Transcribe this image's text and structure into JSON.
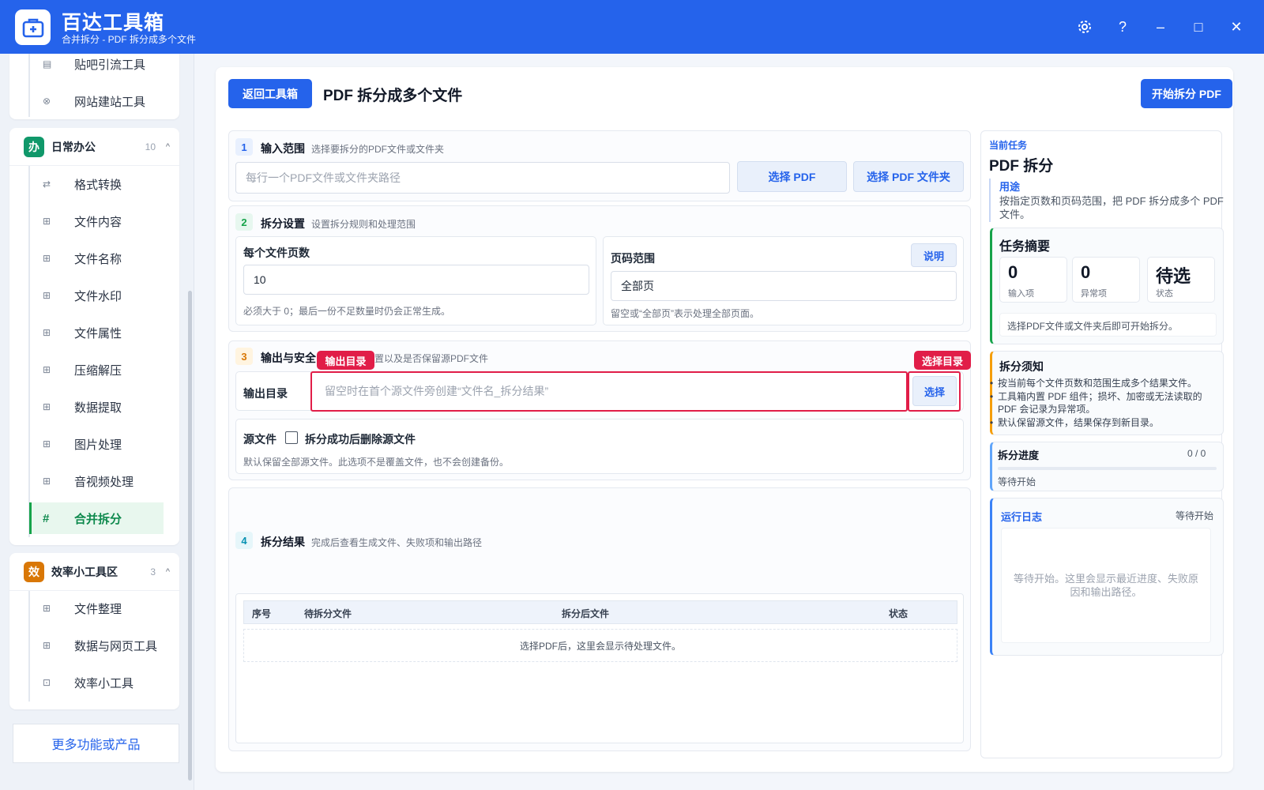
{
  "app": {
    "title": "百达工具箱",
    "subtitle": "合并拆分 - PDF 拆分成多个文件",
    "icons": [
      "settings-icon",
      "help-icon",
      "minimize-icon",
      "maximize-icon",
      "close-icon"
    ],
    "help_glyph": "?",
    "minimize_glyph": "–",
    "maximize_glyph": "□",
    "close_glyph": "✕"
  },
  "sidebar": {
    "top_items": [
      {
        "label": "贴吧引流工具",
        "icon": "document-icon"
      },
      {
        "label": "网站建站工具",
        "icon": "globe-icon"
      }
    ],
    "office_group": {
      "badge": "办",
      "badge_color": "#10986a",
      "title": "日常办公",
      "count": "10",
      "items": [
        {
          "label": "格式转换",
          "icon": "swap-icon"
        },
        {
          "label": "文件内容",
          "icon": "grid-icon"
        },
        {
          "label": "文件名称",
          "icon": "grid-icon"
        },
        {
          "label": "文件水印",
          "icon": "grid-icon"
        },
        {
          "label": "文件属性",
          "icon": "grid-icon"
        },
        {
          "label": "压缩解压",
          "icon": "grid-icon"
        },
        {
          "label": "数据提取",
          "icon": "grid-icon"
        },
        {
          "label": "图片处理",
          "icon": "grid-icon"
        },
        {
          "label": "音视频处理",
          "icon": "grid-icon"
        },
        {
          "label": "合并拆分",
          "icon": "hash-icon",
          "active": true
        }
      ]
    },
    "efficiency_group": {
      "badge": "效",
      "badge_color": "#d97706",
      "title": "效率小工具区",
      "count": "3",
      "items": [
        {
          "label": "文件整理",
          "icon": "grid-icon"
        },
        {
          "label": "数据与网页工具",
          "icon": "grid-icon"
        },
        {
          "label": "效率小工具",
          "icon": "toolbox-icon"
        }
      ]
    },
    "more_label": "更多功能或产品"
  },
  "header": {
    "back_label": "返回工具箱",
    "title": "PDF 拆分成多个文件",
    "start_label": "开始拆分 PDF"
  },
  "sections": {
    "input": {
      "num": "1",
      "title": "输入范围",
      "desc": "选择要拆分的PDF文件或文件夹",
      "placeholder": "每行一个PDF文件或文件夹路径",
      "btn_pdf": "选择 PDF",
      "btn_folder": "选择 PDF 文件夹"
    },
    "split": {
      "num": "2",
      "title": "拆分设置",
      "desc": "设置拆分规则和处理范围",
      "pages_label": "每个文件页数",
      "pages_value": "10",
      "pages_hint": "必须大于 0；最后一份不足数量时仍会正常生成。",
      "range_label": "页码范围",
      "range_help": "说明",
      "range_value": "全部页",
      "range_hint": "留空或“全部页”表示处理全部页面。"
    },
    "output": {
      "num": "3",
      "title": "输出与安全",
      "desc": "置以及是否保留源PDF文件",
      "dir_label": "输出目录",
      "dir_placeholder": "留空时在首个源文件旁创建“文件名_拆分结果”",
      "choose_label": "选择",
      "tag_dir": "输出目录",
      "tag_choose": "选择目录",
      "source_label": "源文件",
      "delete_label": "拆分成功后删除源文件",
      "delete_checked": false,
      "source_hint": "默认保留全部源文件。此选项不是覆盖文件，也不会创建备份。"
    },
    "result": {
      "num": "4",
      "title": "拆分结果",
      "desc": "完成后查看生成文件、失败项和输出路径",
      "columns": [
        "序号",
        "待拆分文件",
        "拆分后文件",
        "状态"
      ],
      "empty": "选择PDF后，这里会显示待处理文件。"
    }
  },
  "right": {
    "current_label": "当前任务",
    "task_title": "PDF 拆分",
    "purpose_label": "用途",
    "purpose_text": "按指定页数和页码范围，把 PDF 拆分成多个 PDF 文件。",
    "summary_title": "任务摘要",
    "stats": [
      {
        "value": "0",
        "label": "输入项"
      },
      {
        "value": "0",
        "label": "异常项"
      },
      {
        "value": "待选",
        "label": "状态"
      }
    ],
    "summary_hint": "选择PDF文件或文件夹后即可开始拆分。",
    "notes_title": "拆分须知",
    "notes": [
      "按当前每个文件页数和范围生成多个结果文件。",
      "工具箱内置 PDF 组件；损坏、加密或无法读取的 PDF 会记录为异常项。",
      "默认保留源文件，结果保存到新目录。"
    ],
    "progress_title": "拆分进度",
    "progress_count": "0 / 0",
    "progress_value": 0,
    "progress_status": "等待开始",
    "log_title": "运行日志",
    "log_status": "等待开始",
    "log_empty": "等待开始。这里会显示最近进度、失败原因和输出路径。"
  },
  "colors": {
    "primary": "#2563eb",
    "accent_green": "#16a34a",
    "alert_red": "#e11d48",
    "notes_orange": "#f59e0b",
    "log_blue": "#3b82f6"
  }
}
